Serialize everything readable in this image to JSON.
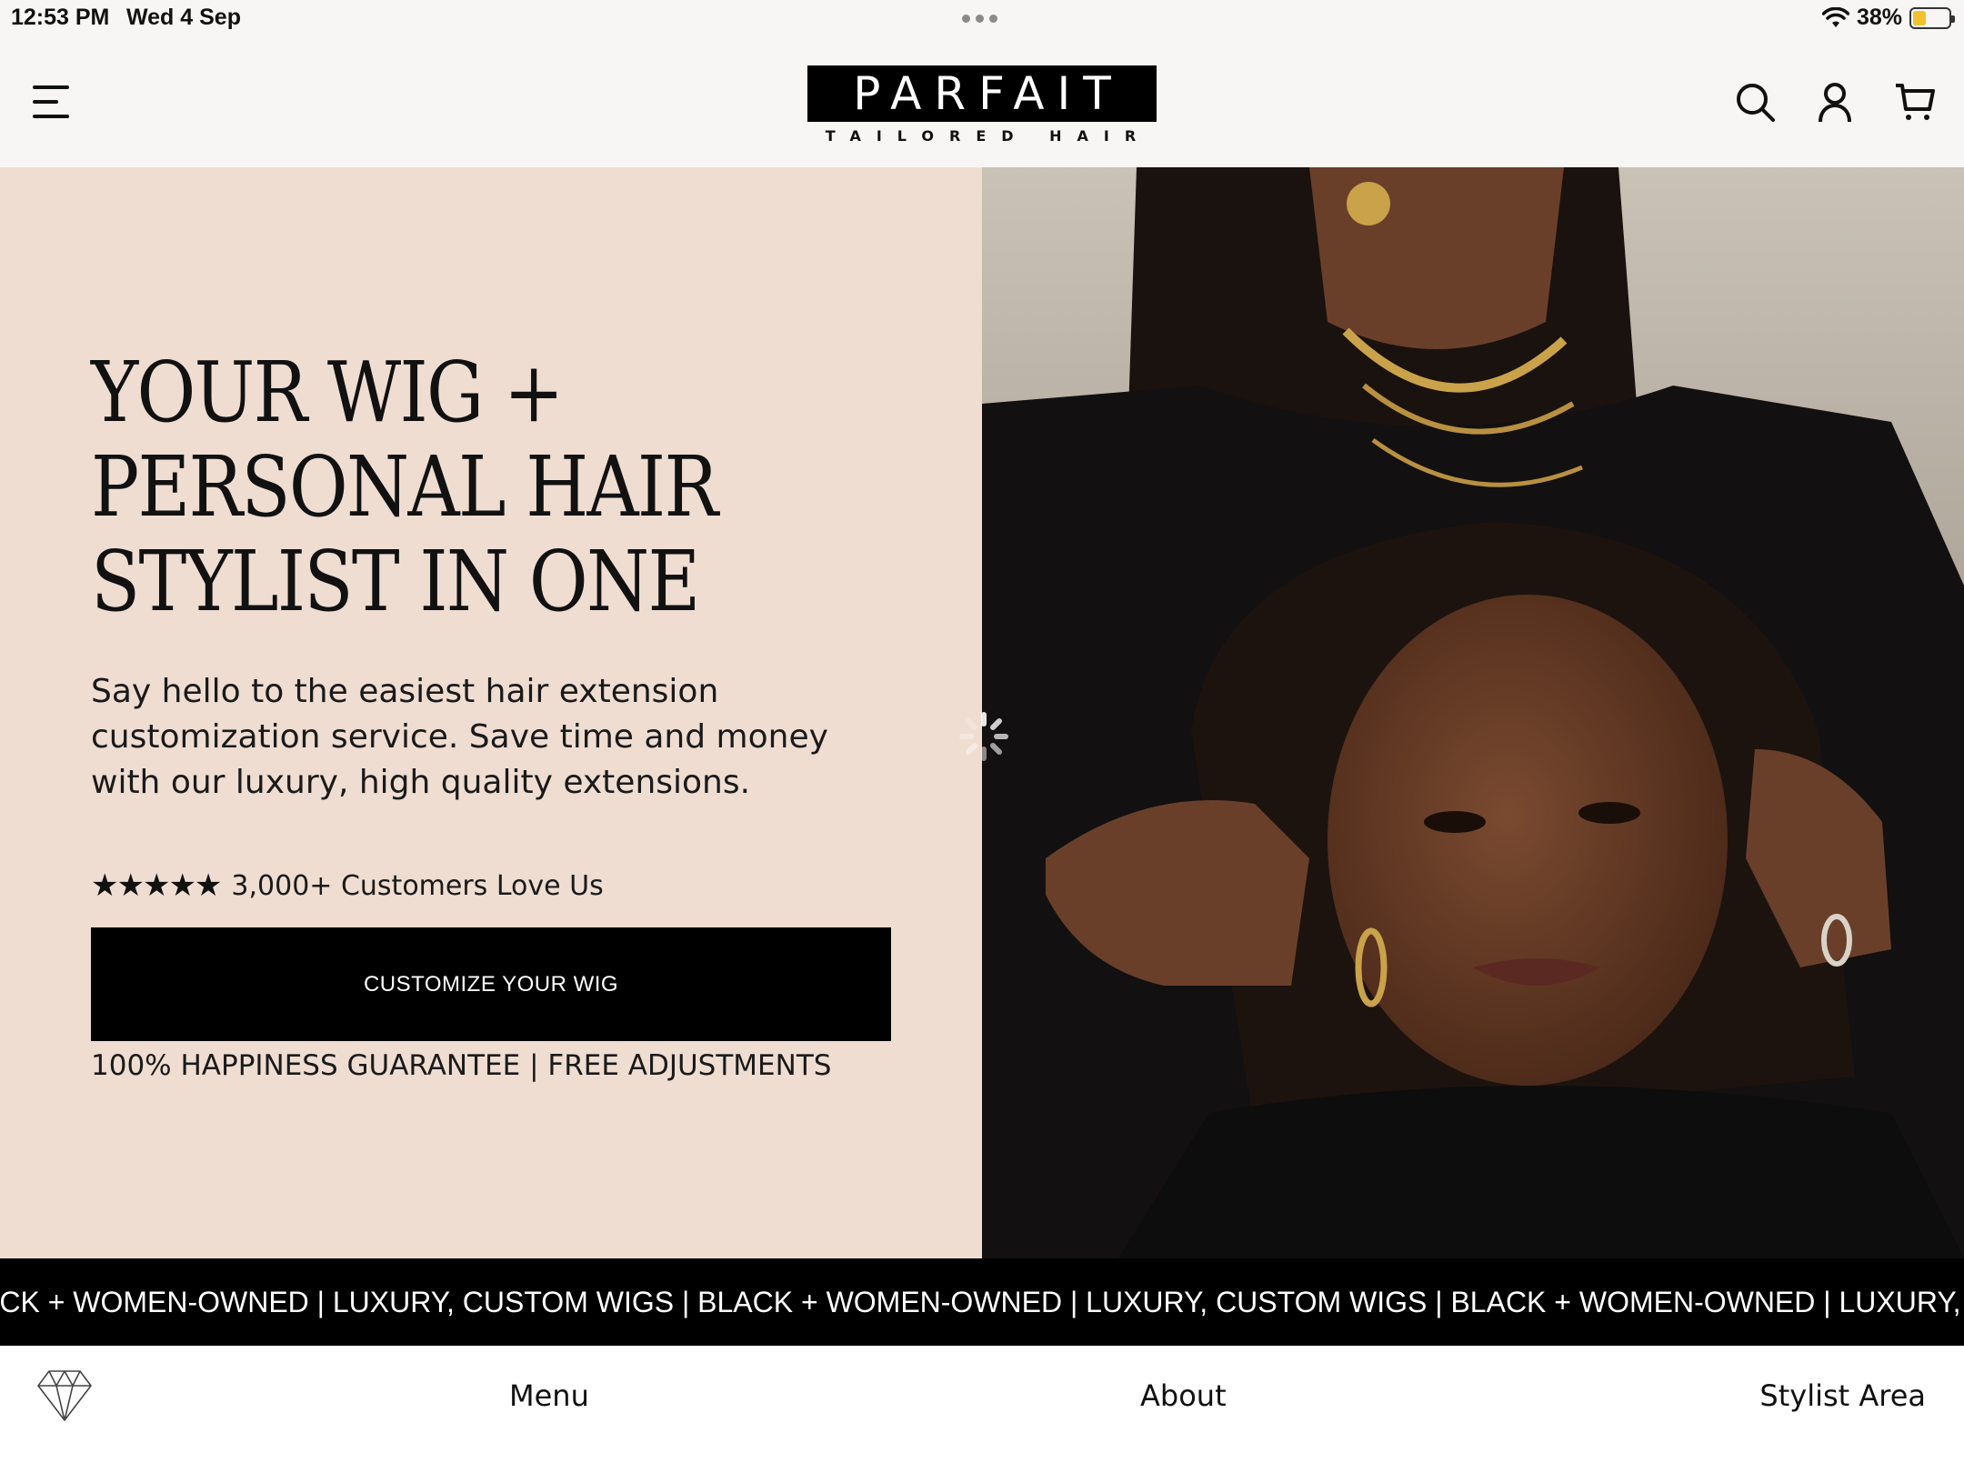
{
  "status_bar": {
    "time": "12:53 PM",
    "date": "Wed 4 Sep",
    "battery": "38%",
    "battery_level": 0.38
  },
  "header": {
    "logo_main": "PARFAIT",
    "logo_tagline": "TAILORED HAIR",
    "icons": [
      "menu-icon",
      "search-icon",
      "account-icon",
      "cart-icon"
    ]
  },
  "hero": {
    "title": "YOUR WIG +\nPERSONAL HAIR\nSTYLIST IN ONE",
    "subtitle": "Say hello to the easiest hair extension customization service. Save time and money with our luxury, high quality extensions.",
    "stars": "★★★★★",
    "rating_text": "3,000+ Customers Love Us",
    "cta_label": "CUSTOMIZE YOUR WIG",
    "guarantee": "100% HAPPINESS GUARANTEE | FREE ADJUSTMENTS",
    "bg_color": "#efddd2"
  },
  "marquee": {
    "text": "ACK + WOMEN-OWNED | LUXURY, CUSTOM WIGS  | BLACK + WOMEN-OWNED | LUXURY, CUSTOM WIGS  | BLACK + WOMEN-OWNED | LUXURY, CUSTOM WIGS"
  },
  "bottom_nav": {
    "menu": "Menu",
    "about": "About",
    "stylist": "Stylist Area"
  }
}
